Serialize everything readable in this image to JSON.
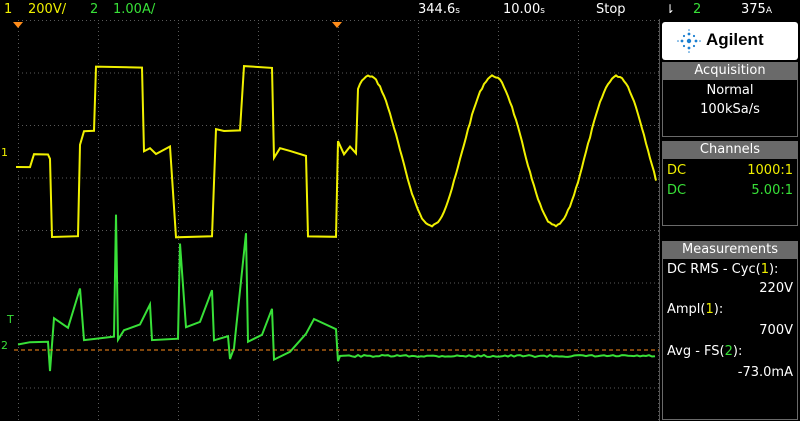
{
  "topbar": {
    "ch1_num": "1",
    "ch1_scale": "200V/",
    "ch2_num": "2",
    "ch2_scale": "1.00A/",
    "time_offset": "344.6",
    "time_offset_unit": "s",
    "time_scale": "10.00",
    "time_scale_unit": "s",
    "run_state": "Stop",
    "trigger_source": "2",
    "trigger_level": "375",
    "trigger_level_unit": "A"
  },
  "panel": {
    "brand": "Agilent",
    "acquisition": {
      "title": "Acquisition",
      "mode": "Normal",
      "rate": "100kSa/s"
    },
    "channels": {
      "title": "Channels",
      "rows": [
        {
          "coupling": "DC",
          "probe": "1000:1",
          "color": "#f0f000"
        },
        {
          "coupling": "DC",
          "probe": "5.00:1",
          "color": "#38e038"
        }
      ]
    },
    "measurements": {
      "title": "Measurements",
      "items": [
        {
          "name": "DC RMS - Cyc",
          "channel": "1",
          "value": "220V"
        },
        {
          "name": "Ampl",
          "channel": "1",
          "value": "700V"
        },
        {
          "name": "Avg - FS",
          "channel": "2",
          "value": "-73.0mA"
        }
      ]
    }
  },
  "markers": {
    "ch1": "1",
    "ch2": "2",
    "trigger": "T"
  },
  "colors": {
    "ch1": "#f0f000",
    "ch2": "#38e038",
    "grid": "#5a5a5a",
    "trigger_marker": "#ff8c1a"
  }
}
